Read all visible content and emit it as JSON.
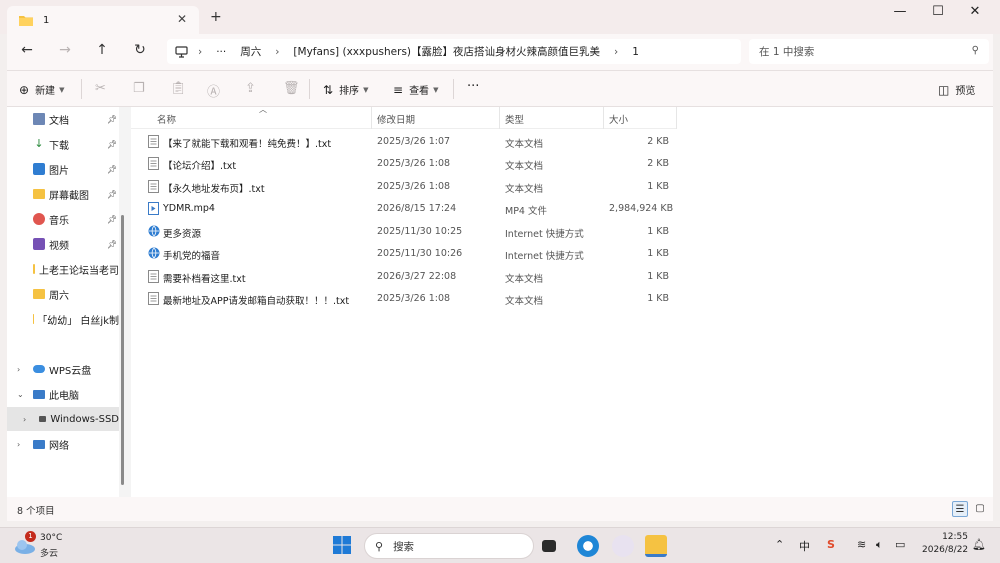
{
  "tab": {
    "title": "1",
    "close": "✕",
    "new": "+"
  },
  "window": {
    "minimize": "—",
    "maximize": "☐",
    "close": "✕"
  },
  "nav": {
    "back": "←",
    "forward": "→",
    "up": "↑",
    "refresh": "↻"
  },
  "address": {
    "more": "···",
    "crumbs": [
      "周六",
      "[Myfans] (xxxpushers)【露脸】夜店搭讪身材火辣高颜值巨乳美",
      "1"
    ],
    "search_placeholder": "在 1 中搜索"
  },
  "toolbar": {
    "new_label": "新建",
    "sort_label": "排序",
    "view_label": "查看",
    "more": "···",
    "preview_label": "预览"
  },
  "sidebar": {
    "items": [
      {
        "label": "文档",
        "icon": "document-icon",
        "pinned": true
      },
      {
        "label": "下载",
        "icon": "download-icon",
        "pinned": true
      },
      {
        "label": "图片",
        "icon": "pictures-icon",
        "pinned": true
      },
      {
        "label": "屏幕截图",
        "icon": "folder-icon",
        "pinned": true
      },
      {
        "label": "音乐",
        "icon": "music-icon",
        "pinned": true
      },
      {
        "label": "视频",
        "icon": "video-icon",
        "pinned": true
      },
      {
        "label": "上老王论坛当老司",
        "icon": "folder-icon",
        "pinned": false
      },
      {
        "label": "周六",
        "icon": "folder-icon",
        "pinned": false
      },
      {
        "label": "「幼幼」 白丝jk制",
        "icon": "folder-icon",
        "pinned": false
      }
    ],
    "tree": [
      {
        "label": "WPS云盘",
        "icon": "cloud-icon",
        "expander": "›"
      },
      {
        "label": "此电脑",
        "icon": "computer-icon",
        "expander": "⌄"
      },
      {
        "label": "Windows-SSD",
        "icon": "drive-icon",
        "expander": "›"
      },
      {
        "label": "网络",
        "icon": "network-icon",
        "expander": "›"
      }
    ]
  },
  "columns": {
    "name": "名称",
    "date": "修改日期",
    "type": "类型",
    "size": "大小"
  },
  "files": [
    {
      "name": "【来了就能下载和观看！纯免费！】.txt",
      "date": "2025/3/26 1:07",
      "type": "文本文档",
      "size": "2 KB",
      "icon": "text-file-icon"
    },
    {
      "name": "【论坛介绍】.txt",
      "date": "2025/3/26 1:08",
      "type": "文本文档",
      "size": "2 KB",
      "icon": "text-file-icon"
    },
    {
      "name": "【永久地址发布页】.txt",
      "date": "2025/3/26 1:08",
      "type": "文本文档",
      "size": "1 KB",
      "icon": "text-file-icon"
    },
    {
      "name": "YDMR.mp4",
      "date": "2026/8/15 17:24",
      "type": "MP4 文件",
      "size": "2,984,924 KB",
      "icon": "video-file-icon"
    },
    {
      "name": "更多资源",
      "date": "2025/11/30 10:25",
      "type": "Internet 快捷方式",
      "size": "1 KB",
      "icon": "internet-shortcut-icon"
    },
    {
      "name": "手机党的福音",
      "date": "2025/11/30 10:26",
      "type": "Internet 快捷方式",
      "size": "1 KB",
      "icon": "internet-shortcut-icon"
    },
    {
      "name": "需要补档看这里.txt",
      "date": "2026/3/27 22:08",
      "type": "文本文档",
      "size": "1 KB",
      "icon": "text-file-icon"
    },
    {
      "name": "最新地址及APP请发邮箱自动获取！！！.txt",
      "date": "2025/3/26 1:08",
      "type": "文本文档",
      "size": "1 KB",
      "icon": "text-file-icon"
    }
  ],
  "status": {
    "count": "8 个项目"
  },
  "taskbar": {
    "badge": "1",
    "temp": "30°C",
    "condition": "多云",
    "search": "搜索",
    "time": "12:55",
    "date": "2026/8/22",
    "ime": "中"
  }
}
